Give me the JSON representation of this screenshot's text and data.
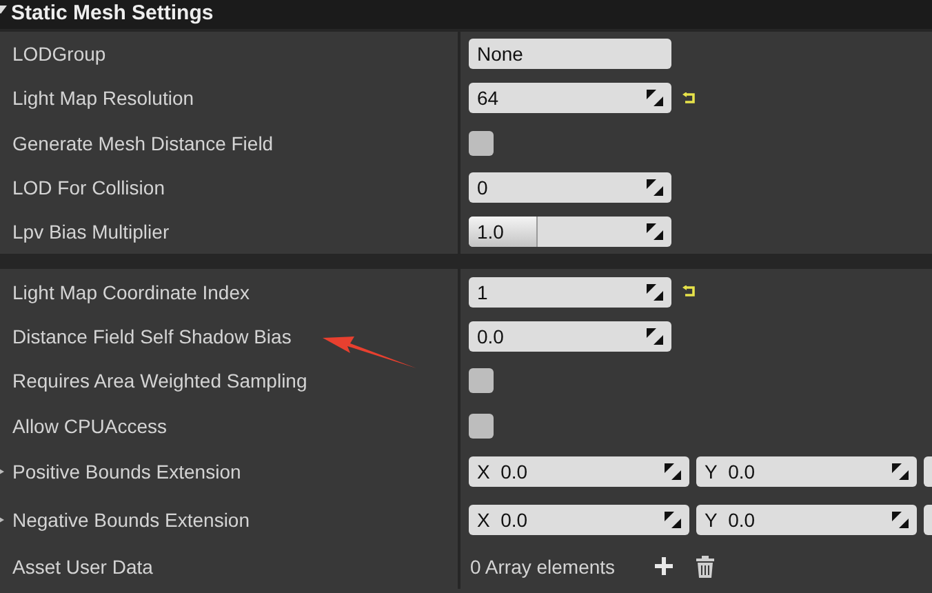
{
  "header": {
    "title": "Static Mesh Settings",
    "expanded": true
  },
  "sections": [
    {
      "rows": [
        {
          "label": "LODGroup",
          "kind": "combo",
          "value": "None"
        },
        {
          "label": "Light Map Resolution",
          "kind": "number",
          "value": "64",
          "modified": true
        },
        {
          "label": "Generate Mesh Distance Field",
          "kind": "checkbox",
          "checked": false
        },
        {
          "label": "LOD For Collision",
          "kind": "number",
          "value": "0"
        },
        {
          "label": "Lpv Bias Multiplier",
          "kind": "slider",
          "value": "1.0",
          "level": 0.33
        }
      ]
    },
    {
      "rows": [
        {
          "label": "Light Map Coordinate Index",
          "kind": "number",
          "value": "1",
          "modified": true
        },
        {
          "label": "Distance Field Self Shadow Bias",
          "kind": "number",
          "value": "0.0"
        },
        {
          "label": "Requires Area Weighted Sampling",
          "kind": "checkbox",
          "checked": false
        },
        {
          "label": "Allow CPUAccess",
          "kind": "checkbox",
          "checked": false
        },
        {
          "label": "Positive Bounds Extension",
          "kind": "vector",
          "expanded": false,
          "components": [
            {
              "axis": "X",
              "value": "0.0"
            },
            {
              "axis": "Y",
              "value": "0.0"
            }
          ]
        },
        {
          "label": "Negative Bounds Extension",
          "kind": "vector",
          "expanded": false,
          "components": [
            {
              "axis": "X",
              "value": "0.0"
            },
            {
              "axis": "Y",
              "value": "0.0"
            }
          ]
        },
        {
          "label": "Asset User Data",
          "kind": "array",
          "value": "0 Array elements"
        }
      ]
    }
  ]
}
